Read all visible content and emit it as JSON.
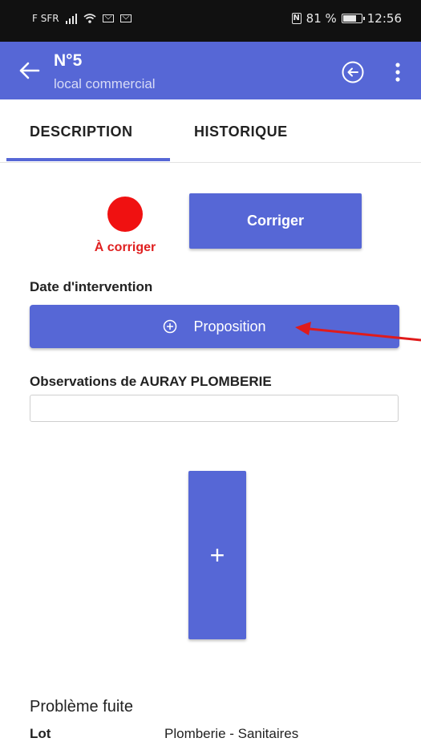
{
  "status_bar": {
    "carrier": "F SFR",
    "battery_percent_text": "81 %",
    "battery_level": 0.81,
    "time": "12:56"
  },
  "app_bar": {
    "title": "N°5",
    "subtitle": "local commercial",
    "icons": [
      "arrow-back-icon",
      "circle-arrow-left-icon",
      "more-vert-icon"
    ]
  },
  "tabs": [
    {
      "label": "DESCRIPTION",
      "selected": true
    },
    {
      "label": "HISTORIQUE",
      "selected": false
    }
  ],
  "status": {
    "label": "À corriger",
    "color": "#f01111",
    "action_label": "Corriger"
  },
  "intervention": {
    "label": "Date d'intervention",
    "button_label": "Proposition"
  },
  "observations": {
    "label": "Observations de AURAY PLOMBERIE",
    "value": "",
    "placeholder": ""
  },
  "add_button": {
    "label": "+"
  },
  "section": {
    "title": "Problème fuite",
    "rows": [
      {
        "key": "Lot",
        "value": "Plomberie - Sanitaires"
      }
    ]
  },
  "colors": {
    "primary": "#5667d6",
    "annotation_arrow": "#e01b1b"
  }
}
